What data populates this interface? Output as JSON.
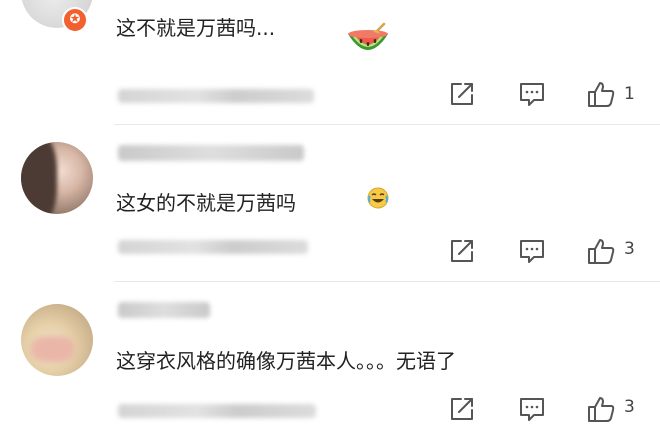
{
  "comments": [
    {
      "text": "这不就是万茜吗...",
      "emoji": "watermelon-emoji",
      "badge": "✪",
      "likes": "1"
    },
    {
      "text": "这女的不就是万茜吗",
      "emoji": "laughing-crying-emoji",
      "likes": "3"
    },
    {
      "text": "这穿衣风格的确像万茜本人。。。无语了",
      "likes": "3"
    }
  ],
  "icons": {
    "share": "share-icon",
    "reply": "comment-icon",
    "like": "thumbs-up-icon"
  },
  "colors": {
    "badge": "#f2602f",
    "text": "#222222",
    "icon": "#555555",
    "divider": "#e8e8e8"
  }
}
